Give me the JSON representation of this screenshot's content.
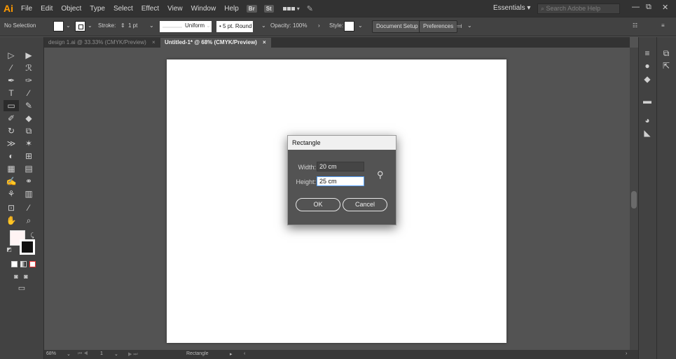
{
  "menubar": {
    "logo": "Ai",
    "items": [
      "File",
      "Edit",
      "Object",
      "Type",
      "Select",
      "Effect",
      "View",
      "Window",
      "Help"
    ],
    "bridge_badge": "Br",
    "stock_badge": "St",
    "workspace": "Essentials",
    "help_search_placeholder": "Search Adobe Help"
  },
  "controlbar": {
    "selection_status": "No Selection",
    "stroke_label": "Stroke:",
    "stroke_weight": "1 pt",
    "stroke_profile": "Uniform",
    "brush": "5 pt. Round",
    "opacity_label": "Opacity:",
    "opacity_value": "100%",
    "style_label": "Style:",
    "document_setup": "Document Setup",
    "preferences": "Preferences"
  },
  "tabs": [
    {
      "label": "design 1.ai @ 33.33% (CMYK/Preview)",
      "active": false
    },
    {
      "label": "Untitled-1* @ 68% (CMYK/Preview)",
      "active": true
    }
  ],
  "statusbar": {
    "zoom": "68%",
    "artboard_number": "1",
    "current_tool": "Rectangle"
  },
  "dialog": {
    "title": "Rectangle",
    "width_label": "Width:",
    "width_value": "20 cm",
    "height_label": "Height:",
    "height_value": "25 cm",
    "ok_label": "OK",
    "cancel_label": "Cancel"
  },
  "colors": {
    "app_bg": "#535353",
    "panel_bg": "#424242",
    "menubar_bg": "#323232",
    "accent_orange": "#ff9a00",
    "focus_blue": "#58a2ff",
    "artboard": "#ffffff"
  }
}
